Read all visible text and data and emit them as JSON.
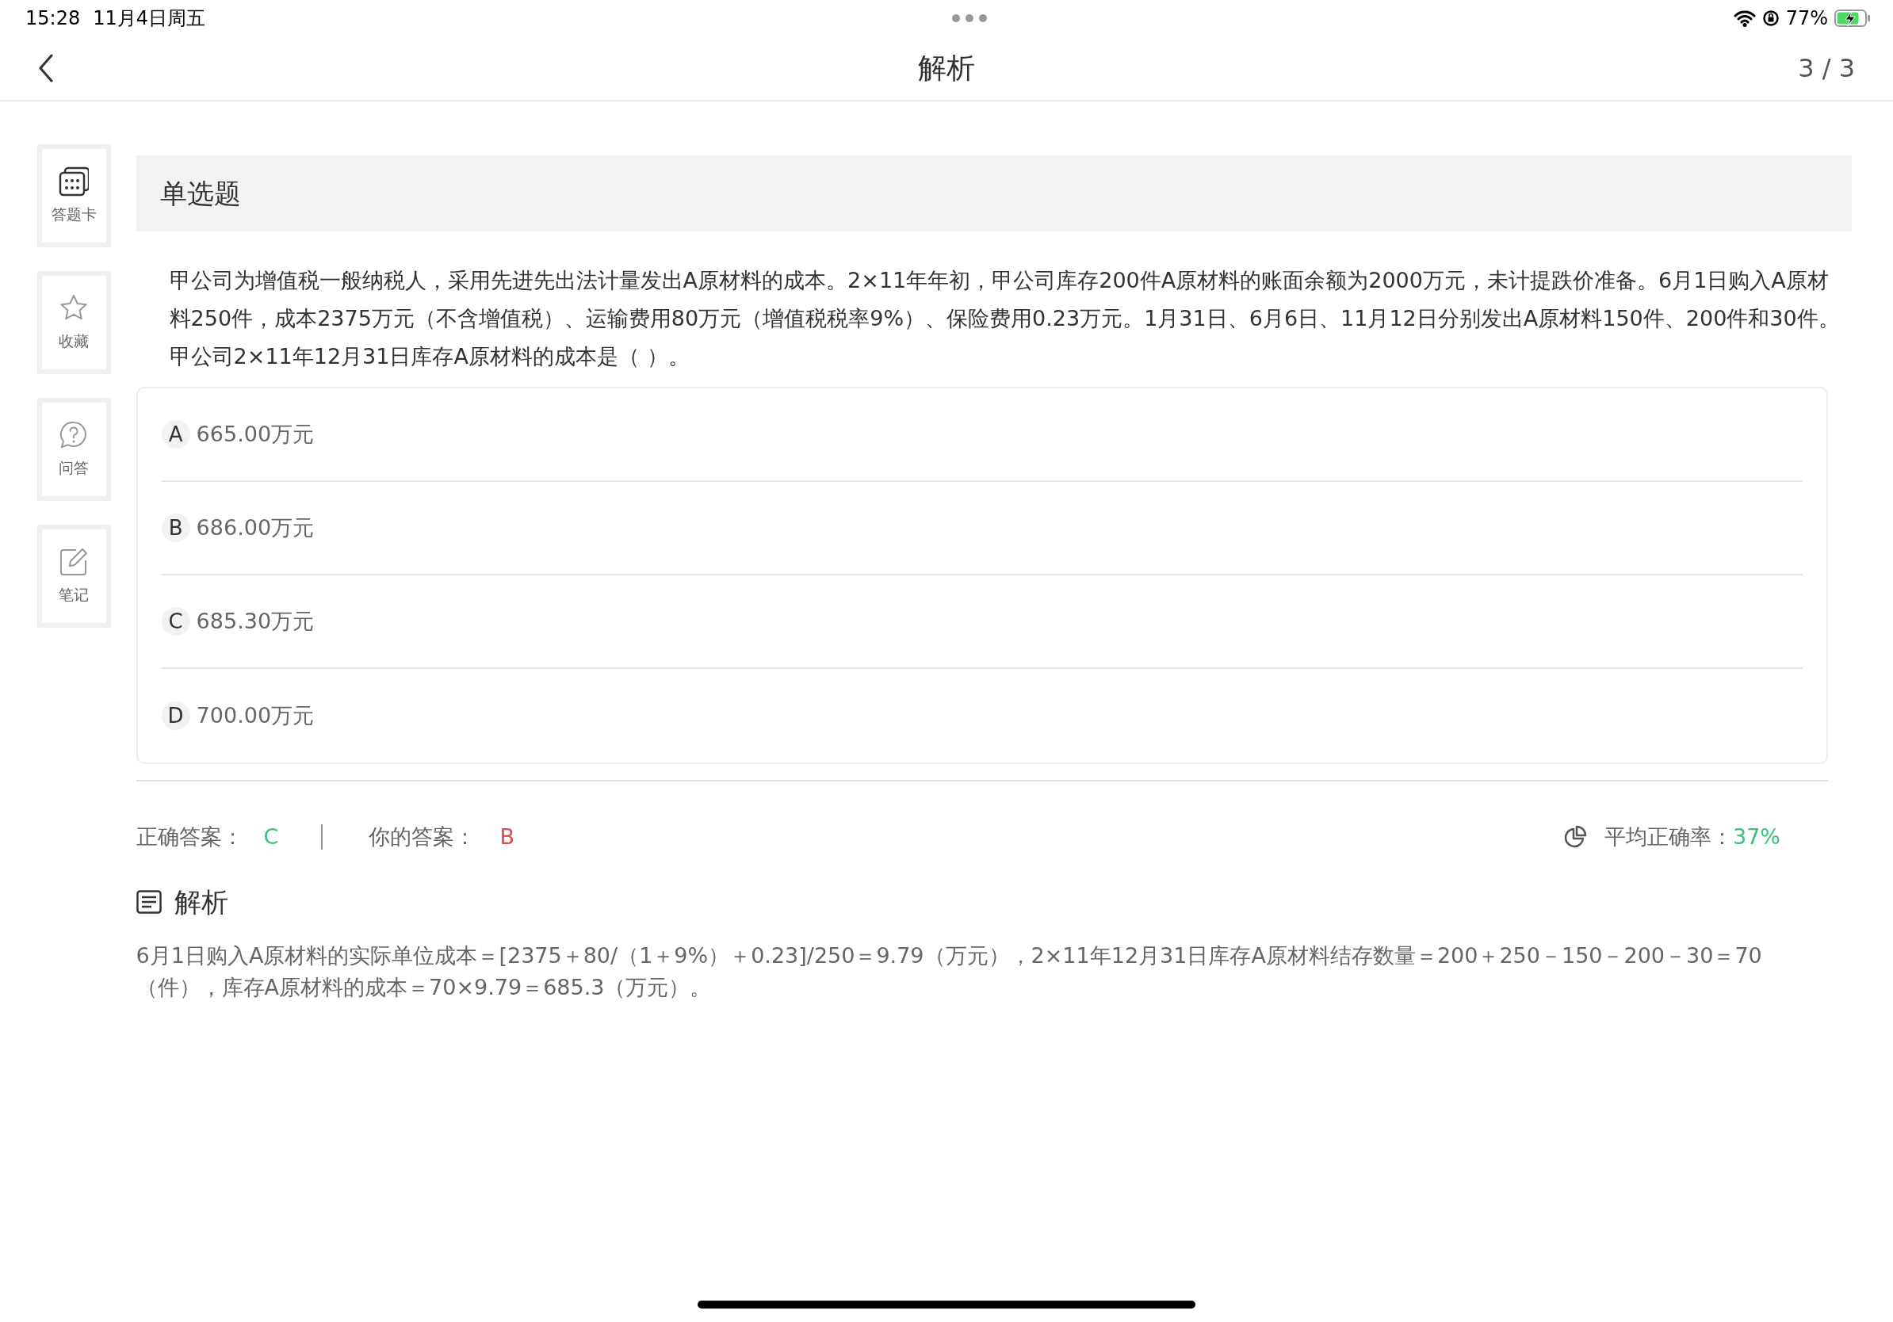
{
  "status_bar": {
    "time": "15:28",
    "date": "11月4日周五",
    "battery": "77%"
  },
  "nav": {
    "title": "解析",
    "counter": "3 / 3"
  },
  "sidebar": {
    "items": [
      {
        "kind": "card",
        "label": "答题卡"
      },
      {
        "kind": "star",
        "label": "收藏"
      },
      {
        "kind": "question",
        "label": "问答"
      },
      {
        "kind": "note",
        "label": "笔记"
      }
    ]
  },
  "question": {
    "type": "单选题",
    "text": "甲公司为增值税一般纳税人，采用先进先出法计量发出A原材料的成本。2×11年年初，甲公司库存200件A原材料的账面余额为2000万元，未计提跌价准备。6月1日购入A原材料250件，成本2375万元（不含增值税）、运输费用80万元（增值税税率9%）、保险费用0.23万元。1月31日、6月6日、11月12日分别发出A原材料150件、200件和30件。甲公司2×11年12月31日库存A原材料的成本是（ ）。",
    "options": [
      {
        "letter": "A",
        "text": "665.00万元"
      },
      {
        "letter": "B",
        "text": "686.00万元"
      },
      {
        "letter": "C",
        "text": "685.30万元"
      },
      {
        "letter": "D",
        "text": "700.00万元"
      }
    ]
  },
  "result": {
    "correct_label": "正确答案：",
    "correct": "C",
    "yours_label": "你的答案：",
    "yours": "B",
    "average_label": "平均正确率：",
    "average": "37%"
  },
  "analysis": {
    "title": "解析",
    "text": "6月1日购入A原材料的实际单位成本＝[2375＋80/（1＋9%）＋0.23]/250＝9.79（万元），2×11年12月31日库存A原材料结存数量＝200＋250－150－200－30＝70（件），库存A原材料的成本＝70×9.79＝685.3（万元）。"
  }
}
